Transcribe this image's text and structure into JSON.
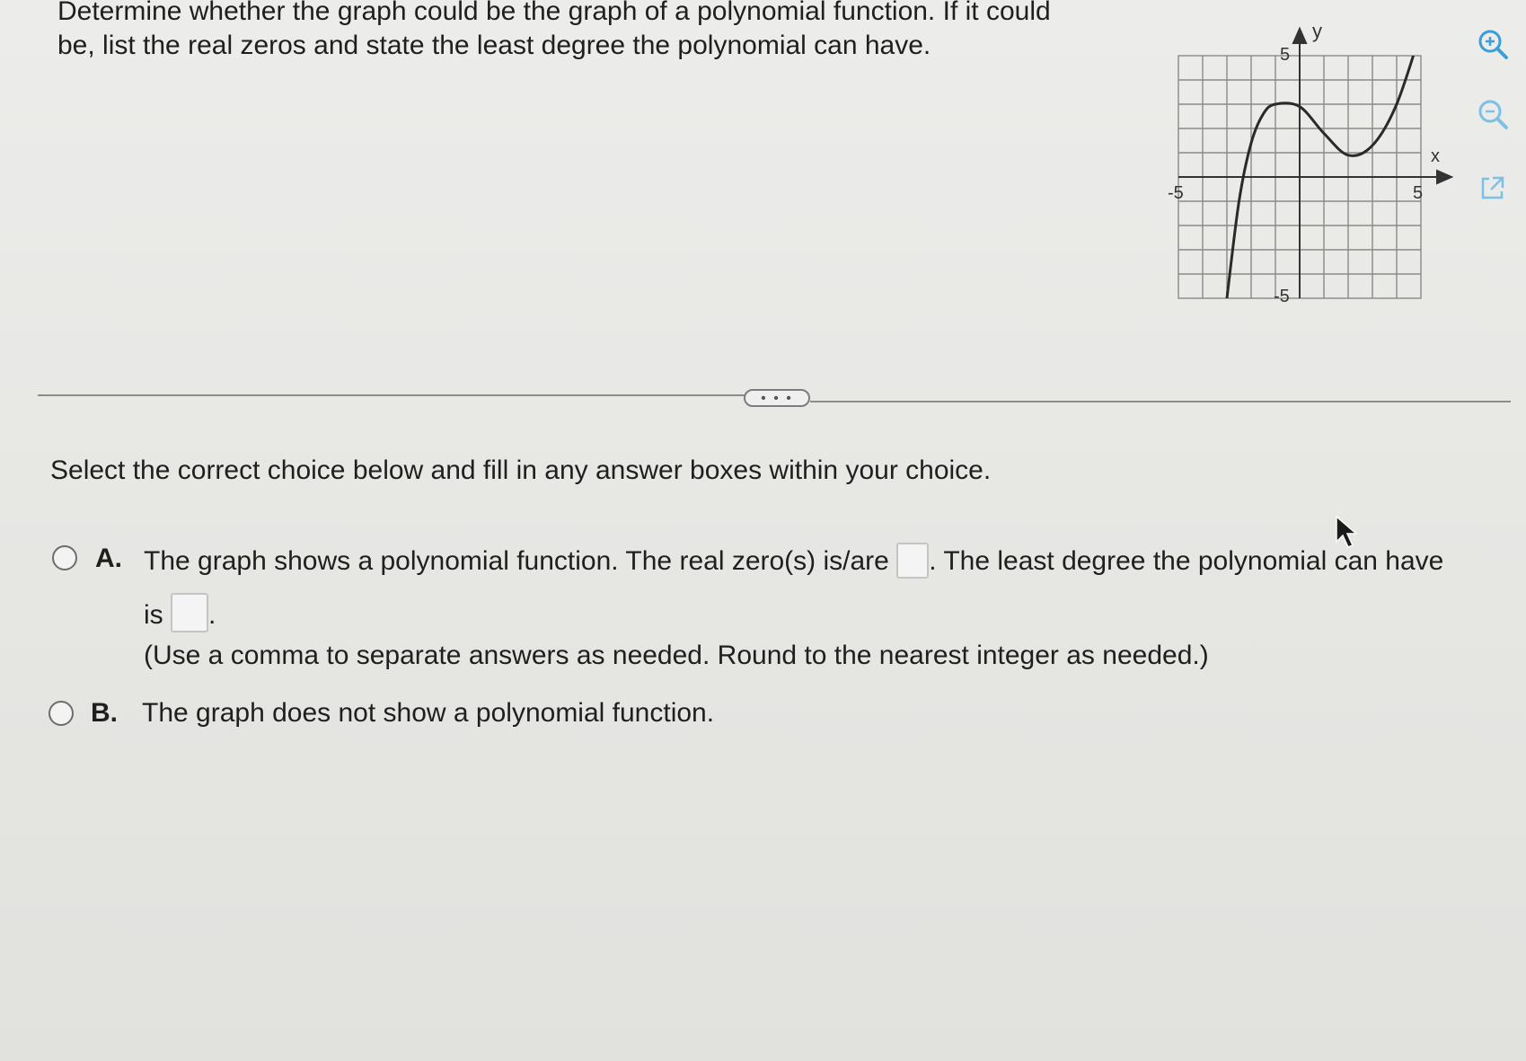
{
  "question": {
    "line1": "Determine whether the graph could be the graph of a polynomial function. If it could",
    "line2": "be, list the real zeros and state the least degree the polynomial can have."
  },
  "graph": {
    "y_axis_label": "y",
    "x_axis_label": "x",
    "y_max_label": "5",
    "y_min_label": "-5",
    "x_min_label": "-5",
    "x_max_label": "5",
    "x_range": [
      -5,
      5
    ],
    "y_range": [
      -5,
      5
    ],
    "curve_points": [
      [
        -3,
        -5
      ],
      [
        -2.5,
        -1
      ],
      [
        -2,
        1.4
      ],
      [
        -1.5,
        2.6
      ],
      [
        -1,
        3
      ],
      [
        0,
        2.9
      ],
      [
        1,
        1.8
      ],
      [
        2,
        0.9
      ],
      [
        3,
        1.3
      ],
      [
        4,
        3
      ],
      [
        5,
        6
      ]
    ],
    "grid": true
  },
  "tools": {
    "zoom_in_icon": "zoom-in-icon",
    "zoom_out_icon": "zoom-out-icon",
    "popout_icon": "external-link-icon",
    "accent": "#3a9fd8"
  },
  "more_button": {
    "label": "• • •"
  },
  "instruction": "Select the correct choice below and fill in any answer boxes within your choice.",
  "choices": {
    "a": {
      "letter": "A.",
      "text1": "The graph shows a polynomial function. The real zero(s) is/are",
      "text2": ". The least degree the polynomial can have",
      "text3": "is",
      "text4": ".",
      "note": "(Use a comma to separate answers as needed.  Round to the nearest integer as needed.)",
      "zeros_value": "",
      "degree_value": ""
    },
    "b": {
      "letter": "B.",
      "text": "The graph does not show a polynomial function."
    }
  }
}
